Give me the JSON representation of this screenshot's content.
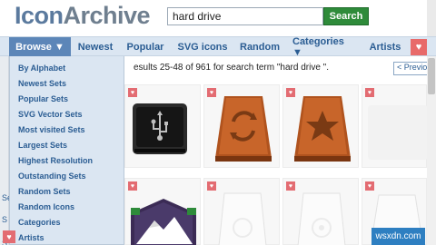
{
  "logo": {
    "part1": "Icon",
    "part2": "Archive"
  },
  "search": {
    "value": "hard drive",
    "button": "Search"
  },
  "nav": {
    "items": [
      "Browse ▼",
      "Newest",
      "Popular",
      "SVG icons",
      "Random",
      "Categories ▼",
      "Artists"
    ],
    "heart": "♥"
  },
  "results": {
    "text": "esults 25-48 of 961 for search term \"hard drive \".",
    "prev": "< Previo"
  },
  "left_frags": [
    "Se",
    "S",
    "S"
  ],
  "dropdown": {
    "items": [
      "By Alphabet",
      "Newest Sets",
      "Popular Sets",
      "SVG Vector Sets",
      "Most visited Sets",
      "Largest Sets",
      "Highest Resolution",
      "Outstanding Sets",
      "Random Sets",
      "Random Icons",
      "Categories",
      "Artists"
    ]
  },
  "cards": [
    {
      "name": "usb-hard-drive-icon",
      "fav": "♥"
    },
    {
      "name": "wooden-sync-drive-icon",
      "fav": "♥"
    },
    {
      "name": "wooden-favorite-drive-icon",
      "fav": "♥"
    },
    {
      "name": "partial-icon",
      "fav": "♥"
    },
    {
      "name": "mountain-drive-icon",
      "fav": "♥"
    },
    {
      "name": "white-drive-icon",
      "fav": "♥"
    },
    {
      "name": "white-drive-icon-2",
      "fav": "♥"
    },
    {
      "name": "white-drive-icon-3",
      "fav": "♥"
    },
    {
      "name": "partial-icon-2",
      "fav": "♥"
    }
  ],
  "watermark": "wsxdn.com",
  "corner_heart": "♥"
}
